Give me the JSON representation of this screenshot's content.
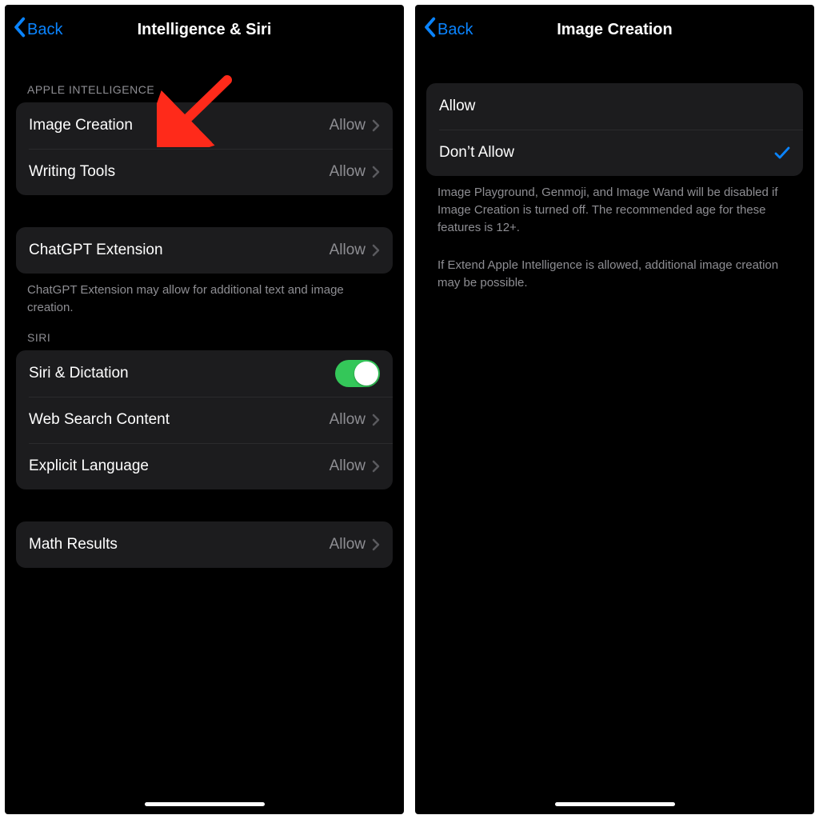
{
  "left": {
    "nav": {
      "back": "Back",
      "title": "Intelligence & Siri"
    },
    "sections": {
      "apple_intelligence_header": "APPLE INTELLIGENCE",
      "image_creation": {
        "label": "Image Creation",
        "value": "Allow"
      },
      "writing_tools": {
        "label": "Writing Tools",
        "value": "Allow"
      },
      "chatgpt_extension": {
        "label": "ChatGPT Extension",
        "value": "Allow"
      },
      "chatgpt_footer": "ChatGPT Extension may allow for additional text and image creation.",
      "siri_header": "SIRI",
      "siri_dictation": {
        "label": "Siri & Dictation",
        "on": true
      },
      "web_search": {
        "label": "Web Search Content",
        "value": "Allow"
      },
      "explicit_lang": {
        "label": "Explicit Language",
        "value": "Allow"
      },
      "math_results": {
        "label": "Math Results",
        "value": "Allow"
      }
    }
  },
  "right": {
    "nav": {
      "back": "Back",
      "title": "Image Creation"
    },
    "options": {
      "allow": {
        "label": "Allow",
        "selected": false
      },
      "dont_allow": {
        "label": "Don’t Allow",
        "selected": true
      }
    },
    "footer1": "Image Playground, Genmoji, and Image Wand will be disabled if Image Creation is turned off. The recommended age for these features is 12+.",
    "footer2": "If Extend Apple Intelligence is allowed, additional image creation may be possible."
  },
  "colors": {
    "accent": "#0a84ff",
    "toggle_on": "#34c759"
  }
}
